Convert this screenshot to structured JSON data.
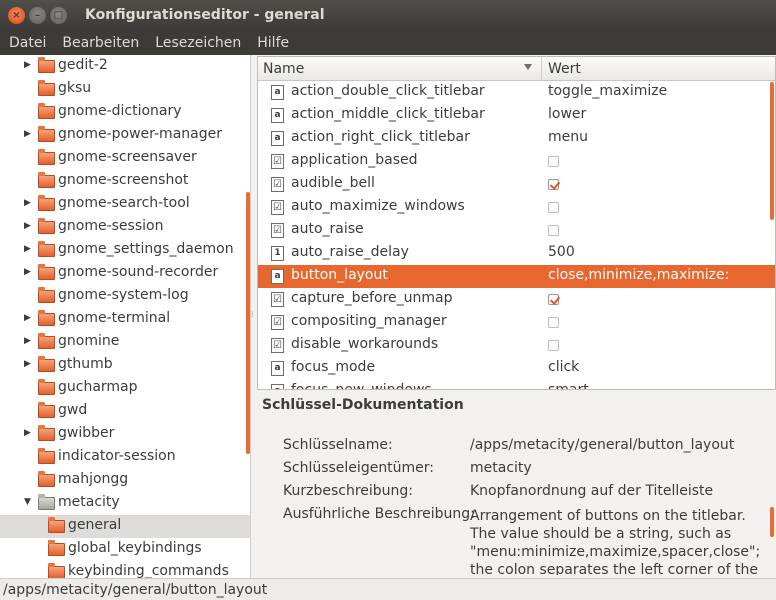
{
  "window": {
    "title": "Konfigurationseditor - general",
    "close_glyph": "×",
    "minimize_glyph": "–",
    "maximize_glyph": "□"
  },
  "menu": [
    "Datei",
    "Bearbeiten",
    "Lesezeichen",
    "Hilfe"
  ],
  "tree": [
    {
      "label": "gedit-2",
      "expander": "right",
      "depth": 0
    },
    {
      "label": "gksu",
      "expander": "none",
      "depth": 0
    },
    {
      "label": "gnome-dictionary",
      "expander": "none",
      "depth": 0
    },
    {
      "label": "gnome-power-manager",
      "expander": "right",
      "depth": 0
    },
    {
      "label": "gnome-screensaver",
      "expander": "none",
      "depth": 0
    },
    {
      "label": "gnome-screenshot",
      "expander": "none",
      "depth": 0
    },
    {
      "label": "gnome-search-tool",
      "expander": "right",
      "depth": 0
    },
    {
      "label": "gnome-session",
      "expander": "right",
      "depth": 0
    },
    {
      "label": "gnome_settings_daemon",
      "expander": "right",
      "depth": 0
    },
    {
      "label": "gnome-sound-recorder",
      "expander": "right",
      "depth": 0
    },
    {
      "label": "gnome-system-log",
      "expander": "none",
      "depth": 0
    },
    {
      "label": "gnome-terminal",
      "expander": "right",
      "depth": 0
    },
    {
      "label": "gnomine",
      "expander": "right",
      "depth": 0
    },
    {
      "label": "gthumb",
      "expander": "right",
      "depth": 0
    },
    {
      "label": "gucharmap",
      "expander": "none",
      "depth": 0
    },
    {
      "label": "gwd",
      "expander": "none",
      "depth": 0
    },
    {
      "label": "gwibber",
      "expander": "right",
      "depth": 0
    },
    {
      "label": "indicator-session",
      "expander": "none",
      "depth": 0
    },
    {
      "label": "mahjongg",
      "expander": "none",
      "depth": 0
    },
    {
      "label": "metacity",
      "expander": "down",
      "depth": 0,
      "open": true
    },
    {
      "label": "general",
      "expander": "none",
      "depth": 1,
      "selected": true
    },
    {
      "label": "global_keybindings",
      "expander": "none",
      "depth": 1
    },
    {
      "label": "keybinding_commands",
      "expander": "none",
      "depth": 1
    }
  ],
  "keys": {
    "col_name": "Name",
    "col_value": "Wert",
    "rows": [
      {
        "name": "action_double_click_titlebar",
        "type": "a",
        "value": "toggle_maximize"
      },
      {
        "name": "action_middle_click_titlebar",
        "type": "a",
        "value": "lower"
      },
      {
        "name": "action_right_click_titlebar",
        "type": "a",
        "value": "menu"
      },
      {
        "name": "application_based",
        "type": "check",
        "checked": false
      },
      {
        "name": "audible_bell",
        "type": "check",
        "checked": true
      },
      {
        "name": "auto_maximize_windows",
        "type": "check",
        "checked": false
      },
      {
        "name": "auto_raise",
        "type": "check",
        "checked": false
      },
      {
        "name": "auto_raise_delay",
        "type": "1",
        "value": "500"
      },
      {
        "name": "button_layout",
        "type": "a",
        "value": "close,minimize,maximize:",
        "selected": true
      },
      {
        "name": "capture_before_unmap",
        "type": "check",
        "checked": true
      },
      {
        "name": "compositing_manager",
        "type": "check",
        "checked": false
      },
      {
        "name": "disable_workarounds",
        "type": "check",
        "checked": false
      },
      {
        "name": "focus_mode",
        "type": "a",
        "value": "click"
      },
      {
        "name": "focus_new_windows",
        "type": "a",
        "value": "smart"
      }
    ]
  },
  "doc": {
    "heading": "Schlüssel-Dokumentation",
    "key_name_label": "Schlüsselname:",
    "key_name": "/apps/metacity/general/button_layout",
    "owner_label": "Schlüsseleigentümer:",
    "owner": "metacity",
    "short_label": "Kurzbeschreibung:",
    "short": "Knopfanordnung auf der Titelleiste",
    "long_label": "Ausführliche Beschreibung:",
    "long": "Arrangement of buttons on the titlebar. The value should be a string, such as \"menu:minimize,maximize,spacer,close\"; the colon separates the left corner of the"
  },
  "status": "/apps/metacity/general/button_layout",
  "colors": {
    "accent": "#e8672f",
    "titlebar": "#3c3b37",
    "selection_tree": "#dedcda"
  }
}
